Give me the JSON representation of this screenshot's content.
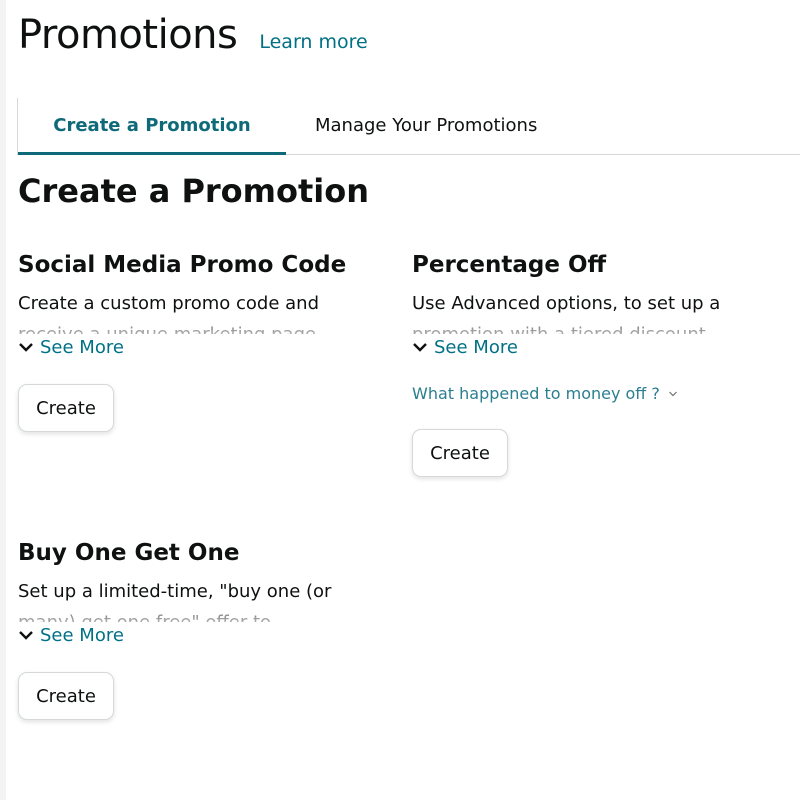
{
  "header": {
    "title": "Promotions",
    "learn_more": "Learn more"
  },
  "tabs": [
    {
      "label": "Create a Promotion",
      "active": true
    },
    {
      "label": "Manage Your Promotions",
      "active": false
    }
  ],
  "section_title": "Create a Promotion",
  "colors": {
    "accent": "#007185",
    "tab_active": "#0e6a79",
    "text": "#0f1111",
    "border": "#d5d9d9"
  },
  "cards": [
    {
      "title": "Social Media Promo Code",
      "desc_line1": "Create a custom promo code and",
      "desc_line2": "receive a unique marketing page",
      "see_more": "See More",
      "button": "Create"
    },
    {
      "title": "Percentage Off",
      "desc_line1": "Use Advanced options, to set up a",
      "desc_line2": "promotion with a tiered discount",
      "see_more": "See More",
      "extra_link": "What happened to money off ?",
      "button": "Create"
    },
    {
      "title": "Buy One Get One",
      "desc_line1": "Set up a limited-time, \"buy one (or",
      "desc_line2": "many) get one free\" offer to",
      "see_more": "See More",
      "button": "Create"
    }
  ],
  "icons": {
    "see_more": "chevron-down-icon",
    "money_off": "chevron-down-small-icon"
  }
}
